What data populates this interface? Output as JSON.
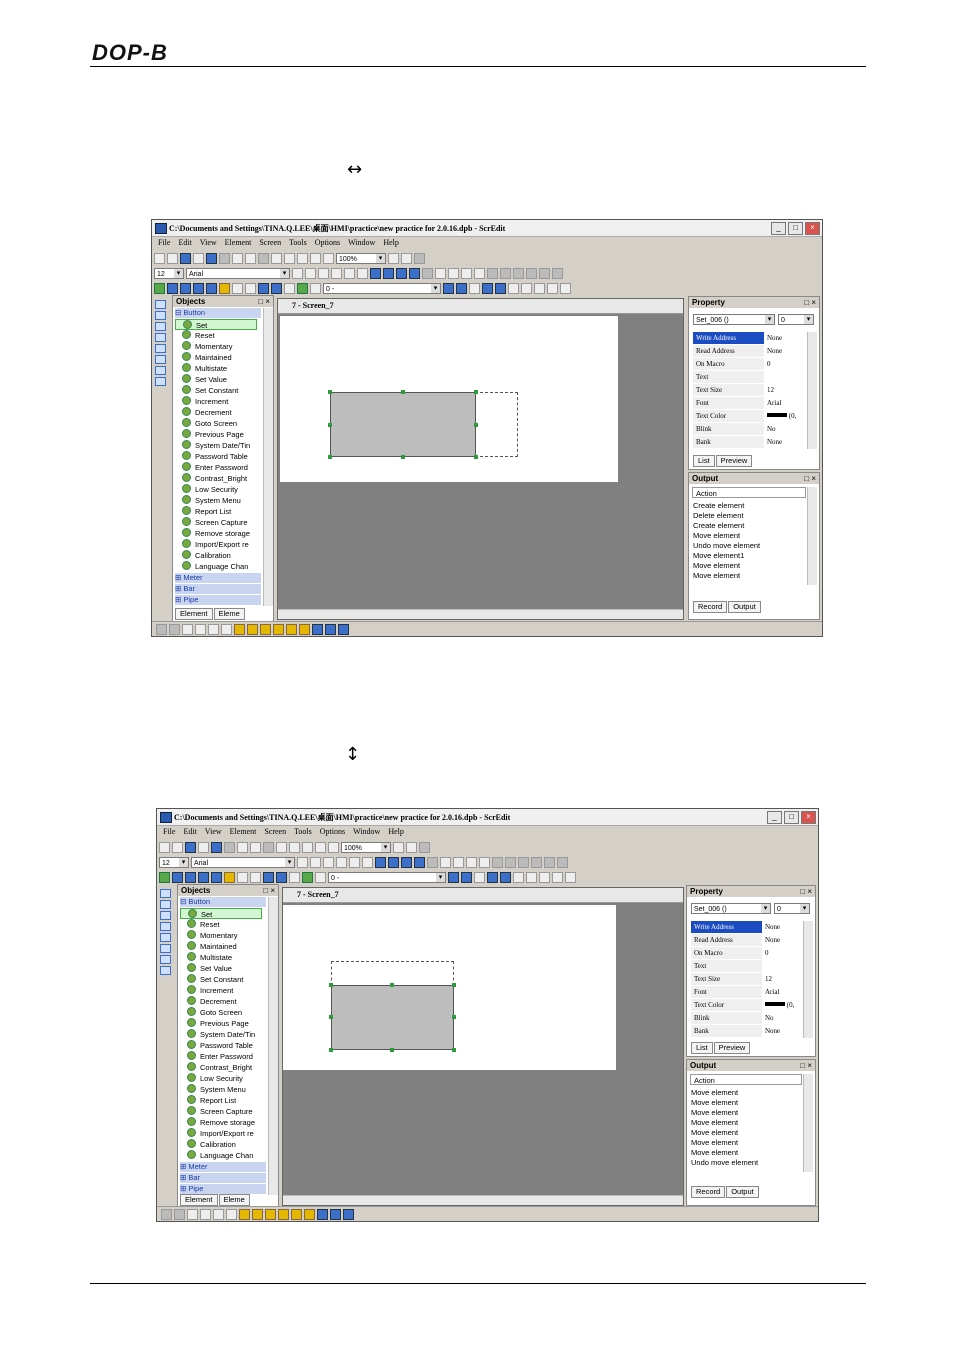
{
  "header": {
    "logo": "DOP-B"
  },
  "cursors": {
    "horizontal": "↔",
    "vertical": "↕"
  },
  "screenshots": [
    {
      "window_title": "C:\\Documents and Settings\\TINA.Q.LEE\\桌面\\HMI\\practice\\new practice for 2.0.16.dpb - ScrEdit",
      "output_lines": [
        "Create element",
        "Delete element",
        "Create element",
        "Move element",
        "Undo move element",
        "Move element1",
        "Move element",
        "Move element"
      ]
    },
    {
      "window_title": "C:\\Documents and Settings\\TINA.Q.LEE\\桌面\\HMI\\practice\\new practice for 2.0.16.dpb - ScrEdit",
      "output_lines": [
        "Move element",
        "Move element",
        "Move element",
        "Move element",
        "Move element",
        "Move element",
        "Move element",
        "Undo move element"
      ]
    }
  ],
  "app": {
    "menu": [
      "File",
      "Edit",
      "View",
      "Element",
      "Screen",
      "Tools",
      "Options",
      "Window",
      "Help"
    ],
    "zoom": "100%",
    "font_size": "12",
    "font_name": "Arial",
    "layer_combo": "0 -",
    "objects_title": "Objects",
    "objects_categories": {
      "button": "Button",
      "meter": "Meter",
      "bar": "Bar",
      "pipe": "Pipe"
    },
    "objects_items": [
      "Set",
      "Reset",
      "Momentary",
      "Maintained",
      "Multistate",
      "Set Value",
      "Set Constant",
      "Increment",
      "Decrement",
      "Goto Screen",
      "Previous Page",
      "System Date/Tin",
      "Password Table",
      "Enter Password",
      "Contrast_Bright",
      "Low Security",
      "System Menu",
      "Report List",
      "Screen Capture",
      "Remove storage",
      "Import/Export re",
      "Calibration",
      "Language Chan"
    ],
    "objects_tabs": [
      "Element",
      "Eleme"
    ],
    "screen_title": "7 - Screen_7",
    "property_title": "Property",
    "property_selected": "Set_006 ()",
    "property_index": "0",
    "properties": [
      {
        "key": "Write Address",
        "value": "None"
      },
      {
        "key": "Read Address",
        "value": "None"
      },
      {
        "key": "On Macro",
        "value": "0"
      },
      {
        "key": "Text",
        "value": ""
      },
      {
        "key": "Text Size",
        "value": "12"
      },
      {
        "key": "Font",
        "value": "Arial"
      },
      {
        "key": "Text Color",
        "value": "(0,"
      },
      {
        "key": "Blink",
        "value": "No"
      },
      {
        "key": "Bank",
        "value": "None"
      }
    ],
    "property_tabs": [
      "List",
      "Preview"
    ],
    "output_title": "Output",
    "output_header": "Action",
    "output_tabs": [
      "Record",
      "Output"
    ]
  },
  "colors": {
    "accent": "#1c4cc2",
    "element_fill": "#bdbdbd",
    "workspace": "#808080"
  }
}
